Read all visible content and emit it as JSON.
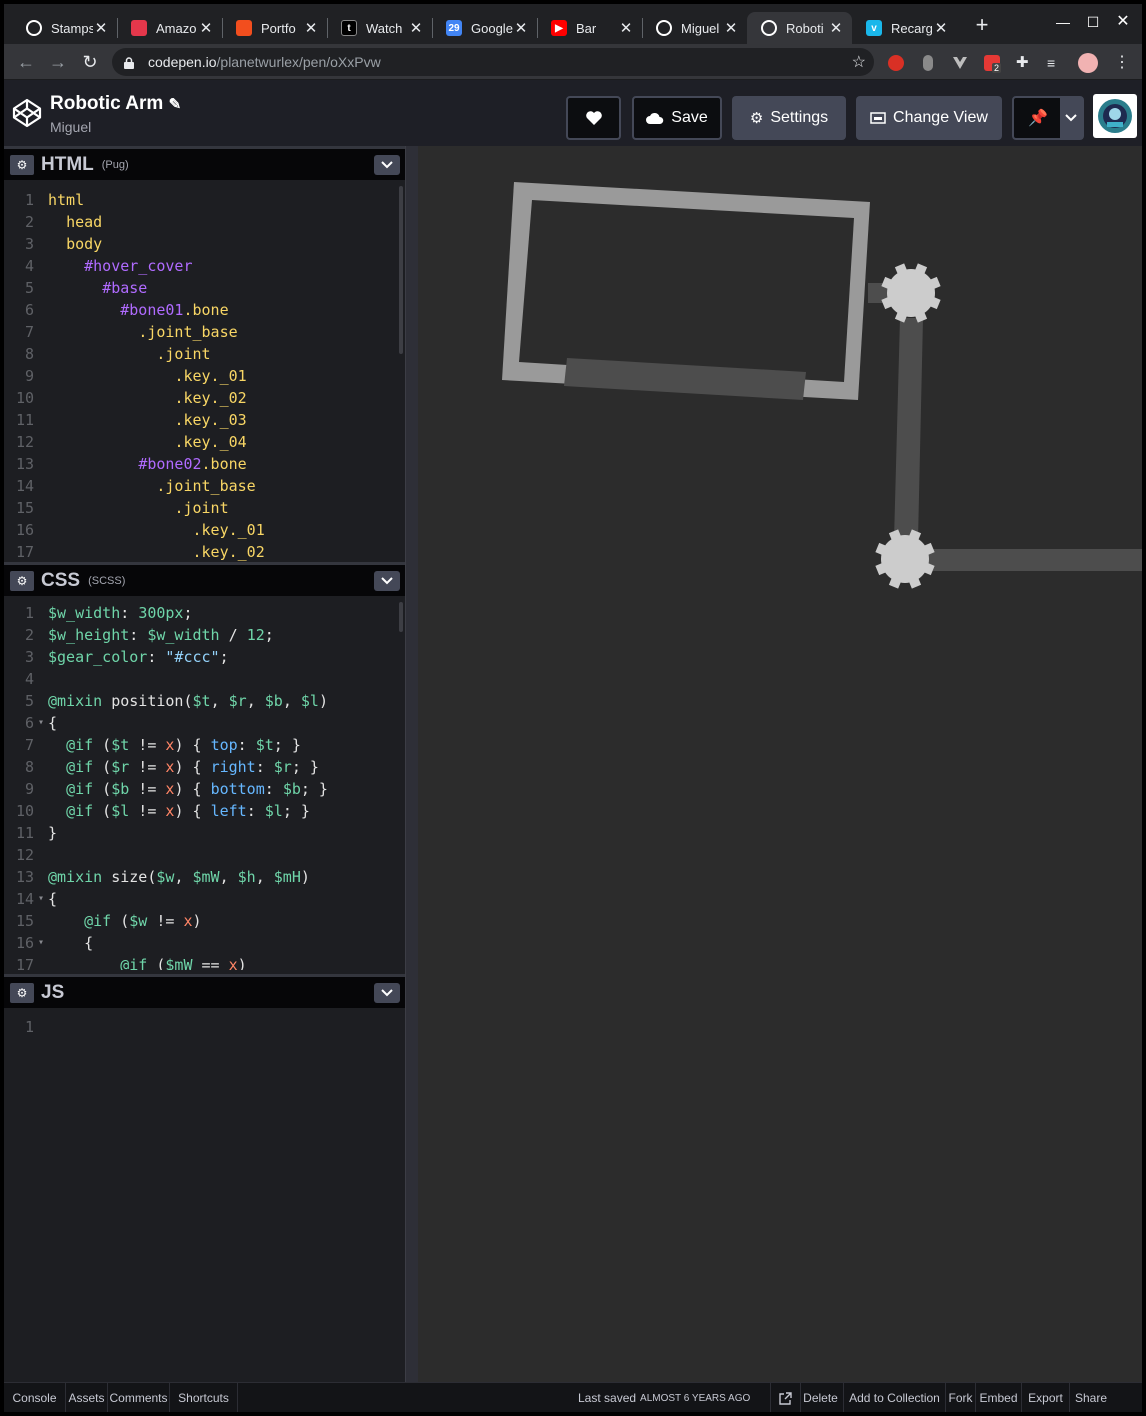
{
  "browser": {
    "tabs": [
      {
        "title": "Stamps",
        "favicon_color": "#ffffff",
        "favicon": "stamps-icon"
      },
      {
        "title": "Amazo",
        "favicon_color": "#e4374b",
        "favicon": "amazon-icon"
      },
      {
        "title": "Portfo",
        "favicon_color": "#f24e1e",
        "favicon": "figma-icon"
      },
      {
        "title": "Watch",
        "favicon_color": "#35363a",
        "favicon": "tumblr-icon"
      },
      {
        "title": "Google",
        "favicon_color": "#4285f4",
        "favicon": "google-calendar-icon"
      },
      {
        "title": "Bar",
        "favicon_color": "#ff0000",
        "favicon": "youtube-icon"
      },
      {
        "title": "Miguel",
        "favicon_color": "#ffffff",
        "favicon": "github-icon"
      },
      {
        "title": "Roboti",
        "favicon_color": "#ffffff",
        "favicon": "codepen-icon"
      },
      {
        "title": "Recarg",
        "favicon_color": "#1ab7ea",
        "favicon": "vimeo-icon"
      }
    ],
    "favicon_letters": {
      "youtube": "▶",
      "vimeo": "v",
      "google": "29",
      "tumblr": "t"
    },
    "url_host": "codepen.io",
    "url_path": "/planetwurlex/pen/oXxPvw",
    "extension_badge": "2"
  },
  "header": {
    "title": "Robotic Arm",
    "author": "Miguel",
    "save_label": "Save",
    "settings_label": "Settings",
    "change_view_label": "Change View"
  },
  "panes": {
    "html": {
      "name": "HTML",
      "preprocessor": "(Pug)"
    },
    "css": {
      "name": "CSS",
      "preprocessor": "(SCSS)"
    },
    "js": {
      "name": "JS",
      "preprocessor": ""
    }
  },
  "html_code": [
    {
      "n": "1",
      "indent": "",
      "parts": [
        [
          "k",
          "html"
        ]
      ]
    },
    {
      "n": "2",
      "indent": "  ",
      "parts": [
        [
          "k",
          "head"
        ]
      ]
    },
    {
      "n": "3",
      "indent": "  ",
      "parts": [
        [
          "k",
          "body"
        ]
      ]
    },
    {
      "n": "4",
      "indent": "    ",
      "parts": [
        [
          "i",
          "#hover_cover"
        ]
      ]
    },
    {
      "n": "5",
      "indent": "      ",
      "parts": [
        [
          "i",
          "#base"
        ]
      ]
    },
    {
      "n": "6",
      "indent": "        ",
      "parts": [
        [
          "i",
          "#bone01"
        ],
        [
          "k",
          ".bone"
        ]
      ]
    },
    {
      "n": "7",
      "indent": "          ",
      "parts": [
        [
          "k",
          ".joint_base"
        ]
      ]
    },
    {
      "n": "8",
      "indent": "            ",
      "parts": [
        [
          "k",
          ".joint"
        ]
      ]
    },
    {
      "n": "9",
      "indent": "              ",
      "parts": [
        [
          "k",
          ".key._01"
        ]
      ]
    },
    {
      "n": "10",
      "indent": "              ",
      "parts": [
        [
          "k",
          ".key._02"
        ]
      ]
    },
    {
      "n": "11",
      "indent": "              ",
      "parts": [
        [
          "k",
          ".key._03"
        ]
      ]
    },
    {
      "n": "12",
      "indent": "              ",
      "parts": [
        [
          "k",
          ".key._04"
        ]
      ]
    },
    {
      "n": "13",
      "indent": "          ",
      "parts": [
        [
          "i",
          "#bone02"
        ],
        [
          "k",
          ".bone"
        ]
      ]
    },
    {
      "n": "14",
      "indent": "            ",
      "parts": [
        [
          "k",
          ".joint_base"
        ]
      ]
    },
    {
      "n": "15",
      "indent": "              ",
      "parts": [
        [
          "k",
          ".joint"
        ]
      ]
    },
    {
      "n": "16",
      "indent": "                ",
      "parts": [
        [
          "k",
          ".key._01"
        ]
      ]
    },
    {
      "n": "17",
      "indent": "                ",
      "parts": [
        [
          "k",
          ".key._02"
        ]
      ]
    }
  ],
  "css_code": [
    {
      "n": "1",
      "fold": false,
      "indent": "",
      "parts": [
        [
          "v",
          "$w_width"
        ],
        [
          "c",
          ": "
        ],
        [
          "num",
          "300px"
        ],
        [
          "c",
          ";"
        ]
      ]
    },
    {
      "n": "2",
      "fold": false,
      "indent": "",
      "parts": [
        [
          "v",
          "$w_height"
        ],
        [
          "c",
          ": "
        ],
        [
          "v",
          "$w_width"
        ],
        [
          "c",
          " / "
        ],
        [
          "num",
          "12"
        ],
        [
          "c",
          ";"
        ]
      ]
    },
    {
      "n": "3",
      "fold": false,
      "indent": "",
      "parts": [
        [
          "v",
          "$gear_color"
        ],
        [
          "c",
          ": "
        ],
        [
          "s",
          "\"#ccc\""
        ],
        [
          "c",
          ";"
        ]
      ]
    },
    {
      "n": "4",
      "fold": false,
      "indent": "",
      "parts": []
    },
    {
      "n": "5",
      "fold": false,
      "indent": "",
      "parts": [
        [
          "at",
          "@mixin"
        ],
        [
          "c",
          " position("
        ],
        [
          "v",
          "$t"
        ],
        [
          "c",
          ", "
        ],
        [
          "v",
          "$r"
        ],
        [
          "c",
          ", "
        ],
        [
          "v",
          "$b"
        ],
        [
          "c",
          ", "
        ],
        [
          "v",
          "$l"
        ],
        [
          "c",
          ")"
        ]
      ]
    },
    {
      "n": "6",
      "fold": true,
      "indent": "",
      "parts": [
        [
          "c",
          "{"
        ]
      ]
    },
    {
      "n": "7",
      "fold": false,
      "indent": "  ",
      "parts": [
        [
          "at",
          "@if"
        ],
        [
          "c",
          " ("
        ],
        [
          "v",
          "$t"
        ],
        [
          "c",
          " != "
        ],
        [
          "x",
          "x"
        ],
        [
          "c",
          ") { "
        ],
        [
          "p",
          "top"
        ],
        [
          "c",
          ": "
        ],
        [
          "v",
          "$t"
        ],
        [
          "c",
          "; }"
        ]
      ]
    },
    {
      "n": "8",
      "fold": false,
      "indent": "  ",
      "parts": [
        [
          "at",
          "@if"
        ],
        [
          "c",
          " ("
        ],
        [
          "v",
          "$r"
        ],
        [
          "c",
          " != "
        ],
        [
          "x",
          "x"
        ],
        [
          "c",
          ") { "
        ],
        [
          "p",
          "right"
        ],
        [
          "c",
          ": "
        ],
        [
          "v",
          "$r"
        ],
        [
          "c",
          "; }"
        ]
      ]
    },
    {
      "n": "9",
      "fold": false,
      "indent": "  ",
      "parts": [
        [
          "at",
          "@if"
        ],
        [
          "c",
          " ("
        ],
        [
          "v",
          "$b"
        ],
        [
          "c",
          " != "
        ],
        [
          "x",
          "x"
        ],
        [
          "c",
          ") { "
        ],
        [
          "p",
          "bottom"
        ],
        [
          "c",
          ": "
        ],
        [
          "v",
          "$b"
        ],
        [
          "c",
          "; }"
        ]
      ]
    },
    {
      "n": "10",
      "fold": false,
      "indent": "  ",
      "parts": [
        [
          "at",
          "@if"
        ],
        [
          "c",
          " ("
        ],
        [
          "v",
          "$l"
        ],
        [
          "c",
          " != "
        ],
        [
          "x",
          "x"
        ],
        [
          "c",
          ") { "
        ],
        [
          "p",
          "left"
        ],
        [
          "c",
          ": "
        ],
        [
          "v",
          "$l"
        ],
        [
          "c",
          "; }"
        ]
      ]
    },
    {
      "n": "11",
      "fold": false,
      "indent": "",
      "parts": [
        [
          "c",
          "}"
        ]
      ]
    },
    {
      "n": "12",
      "fold": false,
      "indent": "",
      "parts": []
    },
    {
      "n": "13",
      "fold": false,
      "indent": "",
      "parts": [
        [
          "at",
          "@mixin"
        ],
        [
          "c",
          " size("
        ],
        [
          "v",
          "$w"
        ],
        [
          "c",
          ", "
        ],
        [
          "v",
          "$mW"
        ],
        [
          "c",
          ", "
        ],
        [
          "v",
          "$h"
        ],
        [
          "c",
          ", "
        ],
        [
          "v",
          "$mH"
        ],
        [
          "c",
          ")"
        ]
      ]
    },
    {
      "n": "14",
      "fold": true,
      "indent": "",
      "parts": [
        [
          "c",
          "{"
        ]
      ]
    },
    {
      "n": "15",
      "fold": false,
      "indent": "    ",
      "parts": [
        [
          "at",
          "@if"
        ],
        [
          "c",
          " ("
        ],
        [
          "v",
          "$w"
        ],
        [
          "c",
          " != "
        ],
        [
          "x",
          "x"
        ],
        [
          "c",
          ")"
        ]
      ]
    },
    {
      "n": "16",
      "fold": true,
      "indent": "    ",
      "parts": [
        [
          "c",
          "{"
        ]
      ]
    },
    {
      "n": "17",
      "fold": false,
      "indent": "        ",
      "parts": [
        [
          "at",
          "@if"
        ],
        [
          "c",
          " ("
        ],
        [
          "v",
          "$mW"
        ],
        [
          "c",
          " == "
        ],
        [
          "x",
          "x"
        ],
        [
          "c",
          ")"
        ]
      ]
    }
  ],
  "js_code": [
    {
      "n": "1",
      "fold": false,
      "indent": "",
      "parts": []
    }
  ],
  "footer": {
    "left": [
      "Console",
      "Assets",
      "Comments",
      "Shortcuts"
    ],
    "saved_label": "Last saved",
    "saved_ago": "ALMOST 6 YEARS AGO",
    "right": [
      "Delete",
      "Add to Collection",
      "Fork",
      "Embed",
      "Export",
      "Share"
    ]
  },
  "colors": {
    "codepen_bg": "#131417",
    "preview_bg": "#2c2c2c",
    "gear": "#cccccc",
    "bone": "#4d4d4d",
    "frame": "#9a9a9a"
  }
}
